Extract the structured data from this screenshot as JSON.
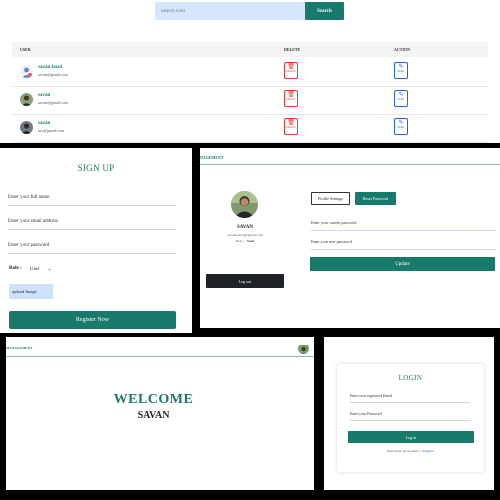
{
  "search": {
    "placeholder": "Search User",
    "button": "Search"
  },
  "table": {
    "headers": [
      "USER",
      "DELETE",
      "ACTION"
    ],
    "delete_label": "Delete",
    "edit_label": "Edit",
    "rows": [
      {
        "name": "savan fazul",
        "email": "savan@gmail.com"
      },
      {
        "name": "savan",
        "email": "savan@gmail.com"
      },
      {
        "name": "savan",
        "email": "sav@gmail.com"
      }
    ]
  },
  "signup": {
    "title": "SIGN UP",
    "name_placeholder": "Enter your full name",
    "email_placeholder": "Enter your email address",
    "password_placeholder": "Enter your password",
    "role_label": "Role :",
    "role_value": "User",
    "upload_label": "upload Image",
    "register_button": "Register Now"
  },
  "profile": {
    "header": "NAGEMENT",
    "name": "SAVAN",
    "email": "savanradcsb@gmail.com",
    "role_label": "Role :",
    "role_value": "User",
    "logout_button": "Log out",
    "tab_settings": "Profile Settings",
    "tab_reset": "Reset Password",
    "current_password_placeholder": "Enter your current password",
    "new_password_placeholder": "Enter your new password",
    "update_button": "Update"
  },
  "welcome": {
    "header": "MANAGEMENT",
    "title": "WELCOME",
    "name": "SAVAN"
  },
  "login": {
    "title": "LOGIN",
    "email_placeholder": "Enter your registered Email",
    "password_placeholder": "Enter your Password",
    "button": "Log in",
    "register_prompt": "Don't have an account ?",
    "register_link": "Register"
  },
  "colors": {
    "accent": "#177a6a",
    "danger": "#e33333",
    "link": "#2563eb",
    "input_bg": "#d6e6fb"
  }
}
